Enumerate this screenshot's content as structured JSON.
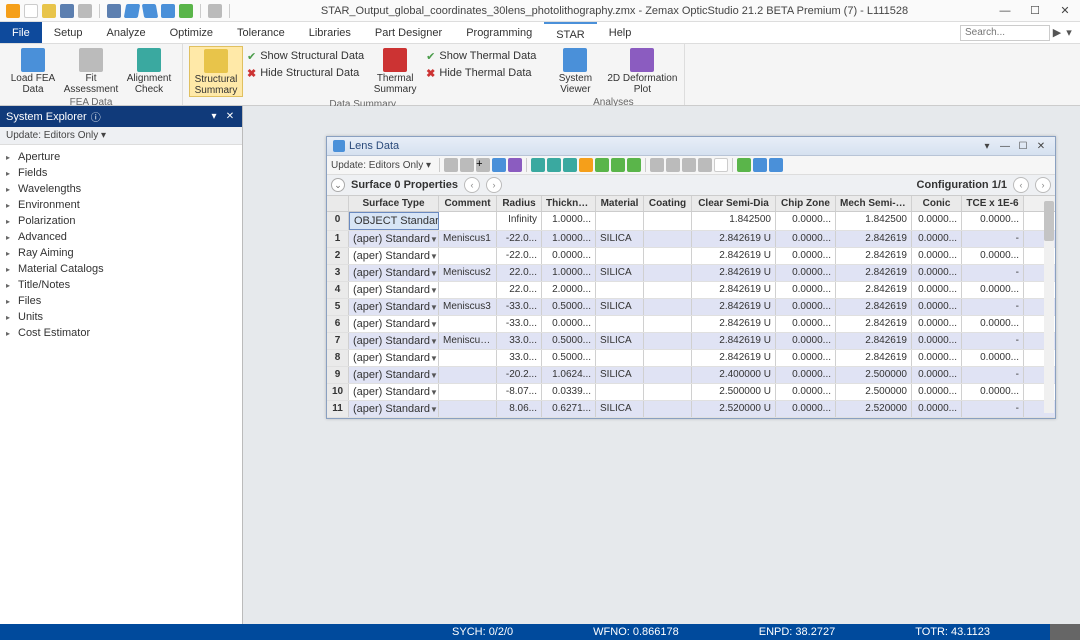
{
  "title": "STAR_Output_global_coordinates_30lens_photolithography.zmx - Zemax OpticStudio 21.2  BETA  Premium (7) - L111528",
  "menus": [
    "File",
    "Setup",
    "Analyze",
    "Optimize",
    "Tolerance",
    "Libraries",
    "Part Designer",
    "Programming",
    "STAR",
    "Help"
  ],
  "search_placeholder": "Search...",
  "ribbon": {
    "g1": {
      "label": "FEA Data",
      "items": [
        "Load FEA Data",
        "Fit Assessment",
        "Alignment Check"
      ]
    },
    "g2": {
      "label": "",
      "items": [
        "Structural Summary"
      ]
    },
    "g3": {
      "label": "Data Summary",
      "show_struct": "Show Structural Data",
      "hide_struct": "Hide Structural Data",
      "thermal": "Thermal Summary",
      "show_therm": "Show Thermal Data",
      "hide_therm": "Hide Thermal Data"
    },
    "g4": {
      "label": "Analyses",
      "items": [
        "System Viewer",
        "2D Deformation Plot"
      ]
    }
  },
  "explorer": {
    "title": "System Explorer",
    "update": "Update: Editors Only ▾",
    "items": [
      "Aperture",
      "Fields",
      "Wavelengths",
      "Environment",
      "Polarization",
      "Advanced",
      "Ray Aiming",
      "Material Catalogs",
      "Title/Notes",
      "Files",
      "Units",
      "Cost Estimator"
    ]
  },
  "lens": {
    "title": "Lens Data",
    "update": "Update: Editors Only ▾",
    "surf_label": "Surface  0 Properties",
    "config": "Configuration 1/1",
    "headers": [
      "",
      "Surface Type",
      "Comment",
      "Radius",
      "Thickness",
      "Material",
      "Coating",
      "Clear Semi-Dia",
      "Chip Zone",
      "Mech Semi-Dia",
      "Conic",
      "TCE x 1E-6"
    ],
    "rows": [
      {
        "n": "0",
        "st": "OBJECT Standard",
        "cm": "",
        "ra": "Infinity",
        "th": "1.0000...",
        "ma": "",
        "co": "",
        "cs": "1.842500",
        "cz": "0.0000...",
        "ms": "1.842500",
        "cn": "0.0000...",
        "tc": "0.0000..."
      },
      {
        "n": "1",
        "st": "(aper)   Standard",
        "cm": "Meniscus1",
        "ra": "-22.0...",
        "th": "1.0000...",
        "ma": "SILICA",
        "co": "",
        "cs": "2.842619  U",
        "cz": "0.0000...",
        "ms": "2.842619",
        "cn": "0.0000...",
        "tc": "-"
      },
      {
        "n": "2",
        "st": "(aper)   Standard",
        "cm": "",
        "ra": "-22.0...",
        "th": "0.0000...",
        "ma": "",
        "co": "",
        "cs": "2.842619  U",
        "cz": "0.0000...",
        "ms": "2.842619",
        "cn": "0.0000...",
        "tc": "0.0000..."
      },
      {
        "n": "3",
        "st": "(aper)   Standard",
        "cm": "Meniscus2",
        "ra": "22.0...",
        "th": "1.0000...",
        "ma": "SILICA",
        "co": "",
        "cs": "2.842619  U",
        "cz": "0.0000...",
        "ms": "2.842619",
        "cn": "0.0000...",
        "tc": "-"
      },
      {
        "n": "4",
        "st": "(aper)   Standard",
        "cm": "",
        "ra": "22.0...",
        "th": "2.0000...",
        "ma": "",
        "co": "",
        "cs": "2.842619  U",
        "cz": "0.0000...",
        "ms": "2.842619",
        "cn": "0.0000...",
        "tc": "0.0000..."
      },
      {
        "n": "5",
        "st": "(aper)   Standard",
        "cm": "Meniscus3",
        "ra": "-33.0...",
        "th": "0.5000...",
        "ma": "SILICA",
        "co": "",
        "cs": "2.842619  U",
        "cz": "0.0000...",
        "ms": "2.842619",
        "cn": "0.0000...",
        "tc": "-"
      },
      {
        "n": "6",
        "st": "(aper)   Standard",
        "cm": "",
        "ra": "-33.0...",
        "th": "0.0000...",
        "ma": "",
        "co": "",
        "cs": "2.842619  U",
        "cz": "0.0000...",
        "ms": "2.842619",
        "cn": "0.0000...",
        "tc": "0.0000..."
      },
      {
        "n": "7",
        "st": "(aper)   Standard",
        "cm": "Meniscus...",
        "ra": "33.0...",
        "th": "0.5000...",
        "ma": "SILICA",
        "co": "",
        "cs": "2.842619  U",
        "cz": "0.0000...",
        "ms": "2.842619",
        "cn": "0.0000...",
        "tc": "-"
      },
      {
        "n": "8",
        "st": "(aper)   Standard",
        "cm": "",
        "ra": "33.0...",
        "th": "0.5000...",
        "ma": "",
        "co": "",
        "cs": "2.842619  U",
        "cz": "0.0000...",
        "ms": "2.842619",
        "cn": "0.0000...",
        "tc": "0.0000..."
      },
      {
        "n": "9",
        "st": "(aper)   Standard",
        "cm": "",
        "ra": "-20.2...",
        "th": "1.0624...",
        "ma": "SILICA",
        "co": "",
        "cs": "2.400000  U",
        "cz": "0.0000...",
        "ms": "2.500000",
        "cn": "0.0000...",
        "tc": "-"
      },
      {
        "n": "10",
        "st": "(aper)   Standard",
        "cm": "",
        "ra": "-8.07...",
        "th": "0.0339...",
        "ma": "",
        "co": "",
        "cs": "2.500000  U",
        "cz": "0.0000...",
        "ms": "2.500000",
        "cn": "0.0000...",
        "tc": "0.0000..."
      },
      {
        "n": "11",
        "st": "(aper)   Standard",
        "cm": "",
        "ra": "8.06...",
        "th": "0.6271...",
        "ma": "SILICA",
        "co": "",
        "cs": "2.520000  U",
        "cz": "0.0000...",
        "ms": "2.520000",
        "cn": "0.0000...",
        "tc": "-"
      }
    ]
  },
  "status": {
    "sych": "SYCH: 0/2/0",
    "wfno": "WFNO: 0.866178",
    "enpd": "ENPD: 38.2727",
    "totr": "TOTR: 43.1123"
  }
}
